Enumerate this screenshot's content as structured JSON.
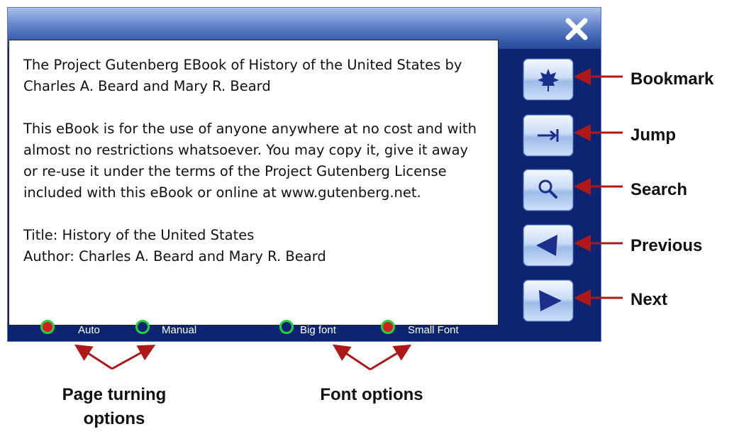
{
  "reader": {
    "paragraph1": "The Project Gutenberg EBook of History of the United States by Charles A. Beard and Mary R. Beard",
    "paragraph2": "This eBook is for the use of anyone anywhere at no cost and with almost no restrictions whatsoever.  You may copy it, give it away or re-use it under the terms of the Project Gutenberg License included with this eBook or online at www.gutenberg.net.",
    "title_line": "Title:  History of the United States",
    "author_line": "Author:  Charles A. Beard and Mary R. Beard"
  },
  "status": {
    "options": [
      {
        "label": "Auto",
        "selected": true
      },
      {
        "label": "Manual",
        "selected": false
      },
      {
        "label": "Big font",
        "selected": false
      },
      {
        "label": "Small Font",
        "selected": true
      }
    ]
  },
  "icons": {
    "close": "close-icon",
    "bookmark": "leaf-icon",
    "jump": "jump-arrow-icon",
    "search": "magnifier-icon",
    "previous": "left-triangle-icon",
    "next": "right-triangle-icon"
  },
  "callouts": {
    "bookmark": "Bookmark",
    "jump": "Jump",
    "search": "Search",
    "previous": "Previous",
    "next": "Next",
    "page_turning": "Page turning options",
    "font": "Font options"
  },
  "colors": {
    "window_bg": "#0d2472",
    "arrow": "#b01818",
    "radio_ring": "#1fd33a",
    "radio_on": "#d62020"
  }
}
